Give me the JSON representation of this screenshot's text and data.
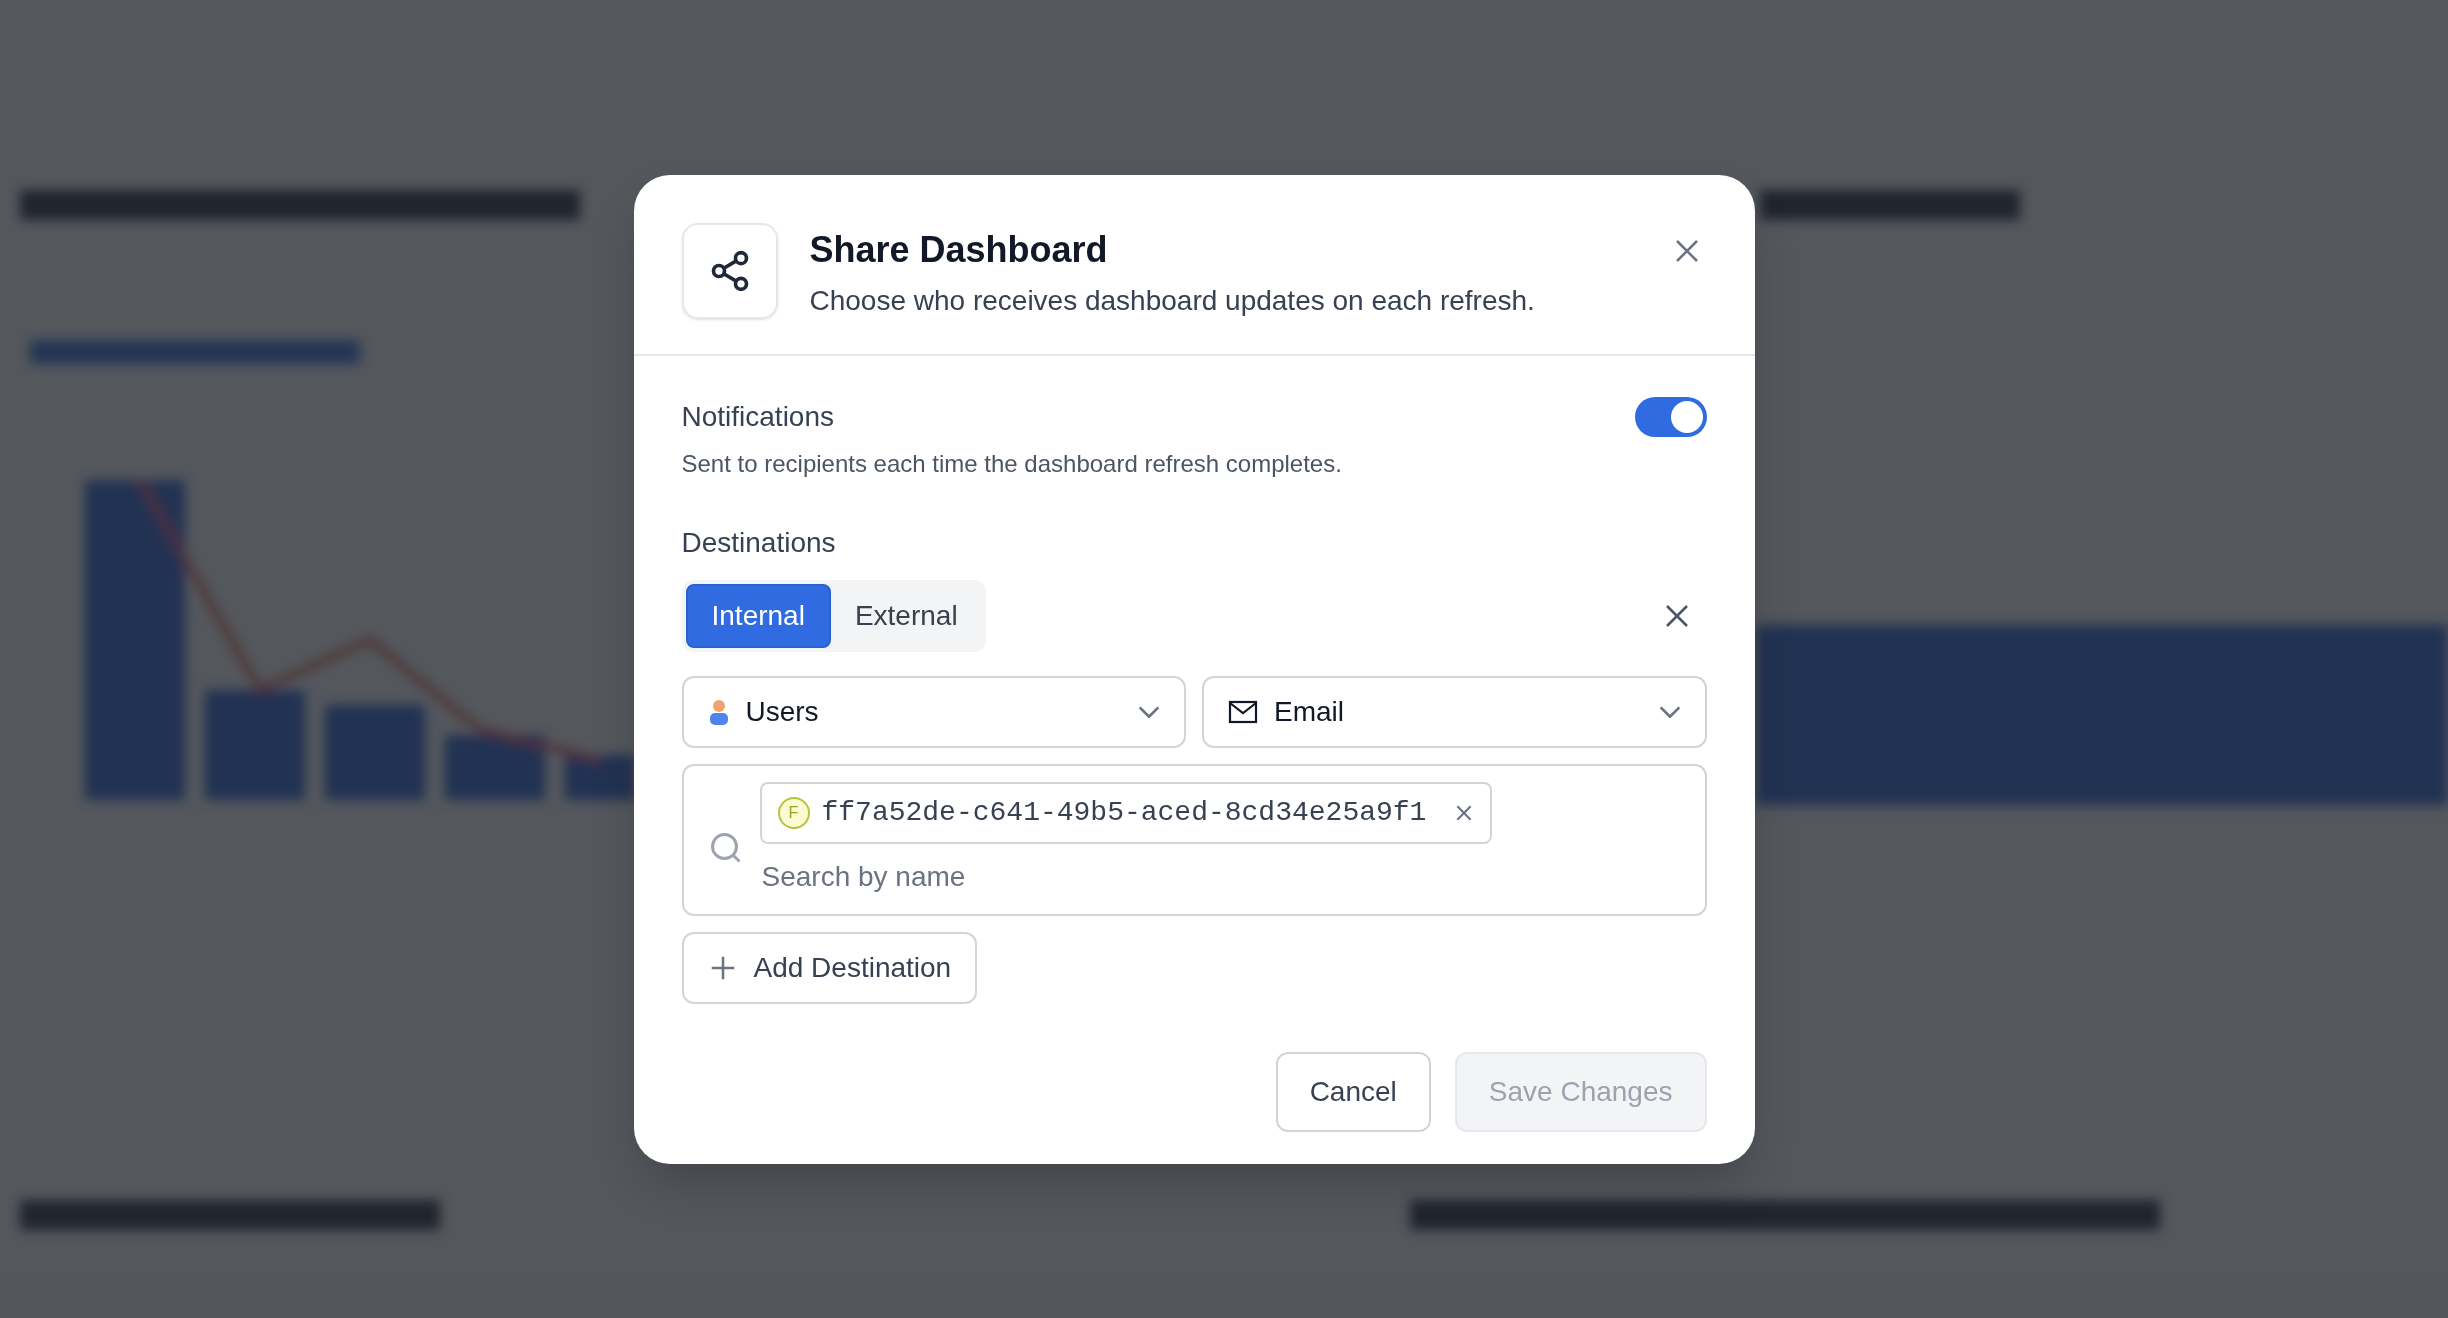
{
  "dialog": {
    "title": "Share Dashboard",
    "subtitle": "Choose who receives dashboard updates on each refresh.",
    "notifications": {
      "label": "Notifications",
      "description": "Sent to recipients each time the dashboard refresh completes.",
      "on": true
    },
    "destinations": {
      "label": "Destinations",
      "tabs": [
        {
          "label": "Internal",
          "selected": true
        },
        {
          "label": "External",
          "selected": false
        }
      ],
      "recipient_type": "Users",
      "channel": "Email",
      "chips": [
        {
          "initial": "F",
          "value": "ff7a52de-c641-49b5-aced-8cd34e25a9f1"
        }
      ],
      "search": {
        "placeholder": "Search by name"
      },
      "add_button": "Add Destination"
    },
    "buttons": [
      {
        "label": "Cancel",
        "disabled": false
      },
      {
        "label": "Save Changes",
        "disabled": true
      }
    ]
  }
}
